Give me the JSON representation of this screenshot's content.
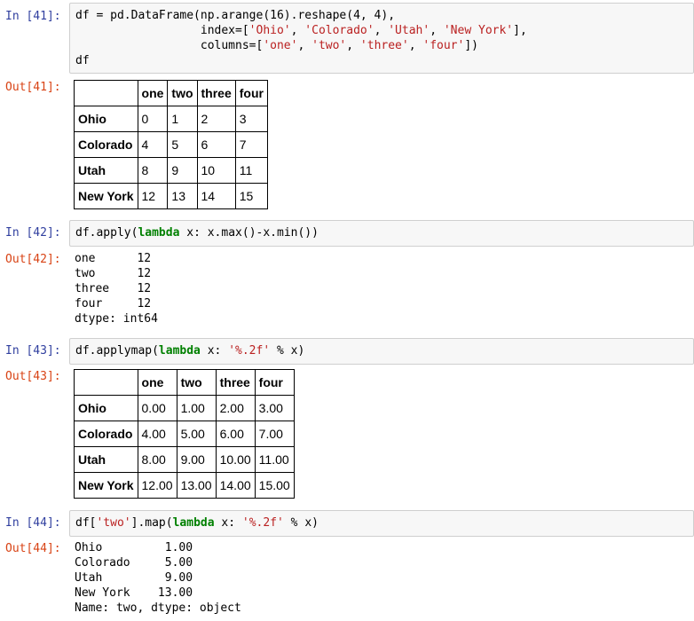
{
  "cells": [
    {
      "in_prompt": "In [41]:",
      "code": [
        [
          {
            "t": "df = pd.DataFrame(np.arange(16).reshape(4, 4),"
          }
        ],
        [
          {
            "t": "                  index=["
          },
          {
            "t": "'Ohio'",
            "c": "str"
          },
          {
            "t": ", "
          },
          {
            "t": "'Colorado'",
            "c": "str"
          },
          {
            "t": ", "
          },
          {
            "t": "'Utah'",
            "c": "str"
          },
          {
            "t": ", "
          },
          {
            "t": "'New York'",
            "c": "str"
          },
          {
            "t": "],"
          }
        ],
        [
          {
            "t": "                  columns=["
          },
          {
            "t": "'one'",
            "c": "str"
          },
          {
            "t": ", "
          },
          {
            "t": "'two'",
            "c": "str"
          },
          {
            "t": ", "
          },
          {
            "t": "'three'",
            "c": "str"
          },
          {
            "t": ", "
          },
          {
            "t": "'four'",
            "c": "str"
          },
          {
            "t": "])"
          }
        ],
        [
          {
            "t": "df"
          }
        ]
      ],
      "out_prompt": "Out[41]:",
      "table": {
        "columns": [
          "one",
          "two",
          "three",
          "four"
        ],
        "rows": [
          {
            "index": "Ohio",
            "values": [
              "0",
              "1",
              "2",
              "3"
            ]
          },
          {
            "index": "Colorado",
            "values": [
              "4",
              "5",
              "6",
              "7"
            ]
          },
          {
            "index": "Utah",
            "values": [
              "8",
              "9",
              "10",
              "11"
            ]
          },
          {
            "index": "New York",
            "values": [
              "12",
              "13",
              "14",
              "15"
            ]
          }
        ]
      }
    },
    {
      "in_prompt": "In [42]:",
      "code": [
        [
          {
            "t": "df.apply("
          },
          {
            "t": "lambda",
            "c": "kw"
          },
          {
            "t": " x: x.max()-x.min())"
          }
        ]
      ],
      "out_prompt": "Out[42]:",
      "text": [
        "one      12",
        "two      12",
        "three    12",
        "four     12",
        "dtype: int64"
      ]
    },
    {
      "in_prompt": "In [43]:",
      "code": [
        [
          {
            "t": "df.applymap("
          },
          {
            "t": "lambda",
            "c": "kw"
          },
          {
            "t": " x: "
          },
          {
            "t": "'%.2f'",
            "c": "str"
          },
          {
            "t": " % x)"
          }
        ]
      ],
      "out_prompt": "Out[43]:",
      "table": {
        "columns": [
          "one",
          "two",
          "three",
          "four"
        ],
        "rows": [
          {
            "index": "Ohio",
            "values": [
              "0.00",
              "1.00",
              "2.00",
              "3.00"
            ]
          },
          {
            "index": "Colorado",
            "values": [
              "4.00",
              "5.00",
              "6.00",
              "7.00"
            ]
          },
          {
            "index": "Utah",
            "values": [
              "8.00",
              "9.00",
              "10.00",
              "11.00"
            ]
          },
          {
            "index": "New York",
            "values": [
              "12.00",
              "13.00",
              "14.00",
              "15.00"
            ]
          }
        ]
      }
    },
    {
      "in_prompt": "In [44]:",
      "code": [
        [
          {
            "t": "df["
          },
          {
            "t": "'two'",
            "c": "str"
          },
          {
            "t": "].map("
          },
          {
            "t": "lambda",
            "c": "kw"
          },
          {
            "t": " x: "
          },
          {
            "t": "'%.2f'",
            "c": "str"
          },
          {
            "t": " % x)"
          }
        ]
      ],
      "out_prompt": "Out[44]:",
      "text": [
        "Ohio         1.00",
        "Colorado     5.00",
        "Utah         9.00",
        "New York    13.00",
        "Name: two, dtype: object"
      ]
    }
  ]
}
